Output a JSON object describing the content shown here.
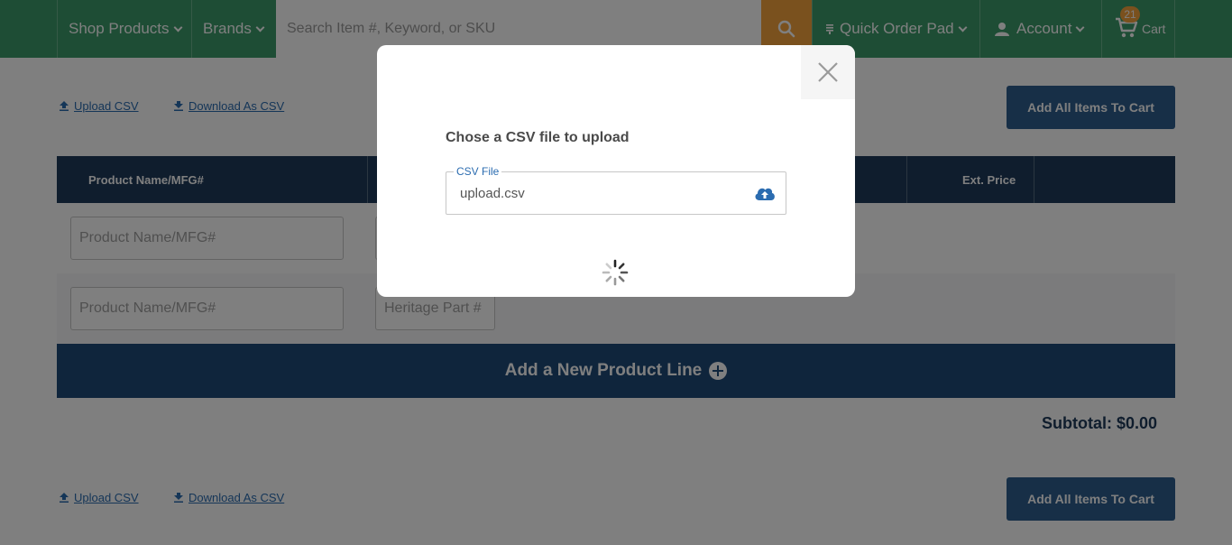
{
  "header": {
    "shop_products": "Shop Products",
    "brands": "Brands",
    "search_placeholder": "Search Item #, Keyword, or SKU",
    "quick_order_pad": "Quick Order Pad",
    "account": "Account",
    "cart_label": "Cart",
    "cart_count": "21"
  },
  "toolbar": {
    "upload_csv": "Upload CSV",
    "download_csv": "Download As CSV",
    "add_all": "Add All Items To Cart"
  },
  "table": {
    "col_product": "Product Name/MFG#",
    "col_ext_price": "Ext. Price",
    "product_placeholder": "Product Name/MFG#",
    "heritage_placeholder": "Heritage Part #"
  },
  "add_line": "Add a New Product Line",
  "subtotal": "Subtotal: $0.00",
  "modal": {
    "title": "Chose a CSV file to upload",
    "field_label": "CSV File",
    "field_value": "upload.csv"
  },
  "colors": {
    "header_bg": "#3c9b6a",
    "search_button": "#f4a23c",
    "table_header": "#1f3b5a",
    "add_line_bg": "#1f4a78",
    "primary_button": "#2f5f8f"
  },
  "icons": [
    "chevron-down-icon",
    "search-icon",
    "list-icon",
    "user-icon",
    "cart-icon",
    "upload-arrow-icon",
    "download-arrow-icon",
    "plus-circle-icon",
    "close-icon",
    "cloud-upload-icon",
    "loading-spinner-icon"
  ]
}
